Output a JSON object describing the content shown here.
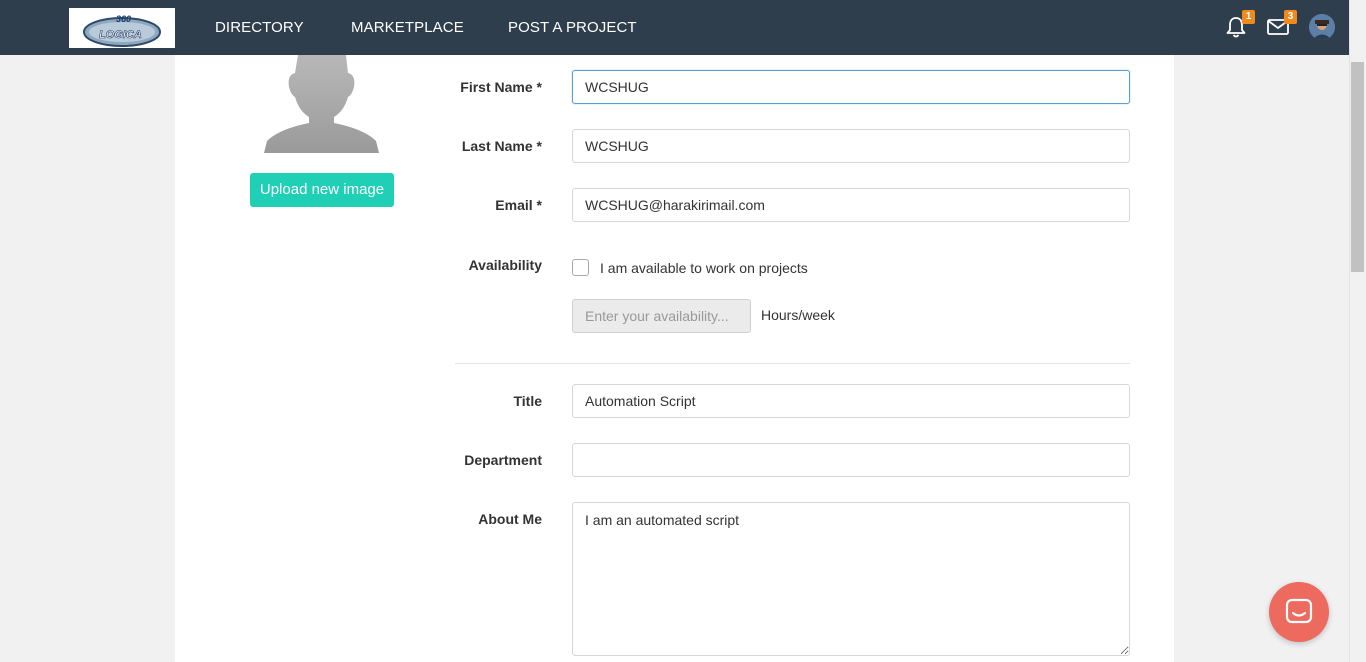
{
  "nav": {
    "logo_top": "360",
    "logo_text": "LOGICA",
    "links": [
      "DIRECTORY",
      "MARKETPLACE",
      "POST A PROJECT"
    ],
    "notifications_count": "1",
    "messages_count": "3"
  },
  "profile": {
    "upload_label": "Upload new image"
  },
  "form": {
    "first_name": {
      "label": "First Name *",
      "value": "WCSHUG"
    },
    "last_name": {
      "label": "Last Name *",
      "value": "WCSHUG"
    },
    "email": {
      "label": "Email *",
      "value": "WCSHUG@harakirimail.com"
    },
    "availability": {
      "label": "Availability",
      "checkbox_label": "I am available to work on projects",
      "checked": false,
      "hours_placeholder": "Enter your availability...",
      "hours_unit": "Hours/week"
    },
    "title": {
      "label": "Title",
      "value": "Automation Script"
    },
    "department": {
      "label": "Department",
      "value": ""
    },
    "about": {
      "label": "About Me",
      "value": "I am an automated script"
    }
  },
  "colors": {
    "nav_bg": "#2f3e4d",
    "accent": "#1fcfb6",
    "badge": "#f18a1c",
    "chat": "#ec6a5e"
  }
}
